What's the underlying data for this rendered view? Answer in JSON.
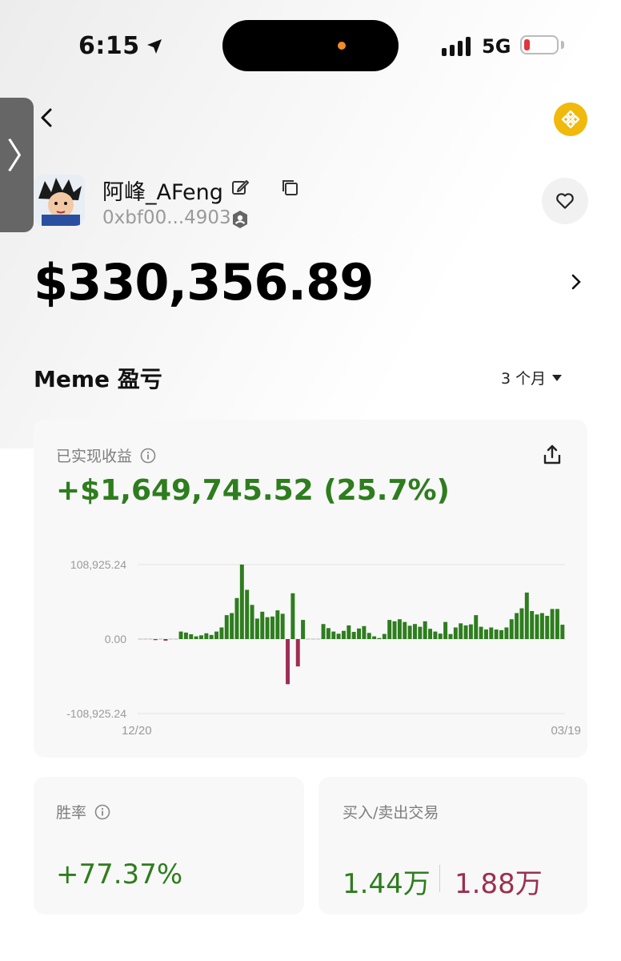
{
  "status_bar": {
    "time": "6:15",
    "network": "5G"
  },
  "profile": {
    "name": "阿峰_AFeng",
    "address": "0xbf00...4903",
    "balance": "$330,356.89"
  },
  "section": {
    "title": "Meme 盈亏",
    "period": "3 个月"
  },
  "pnl": {
    "label": "已实现收益",
    "value": "+$1,649,745.52 (25.7%)"
  },
  "chart_data": {
    "type": "bar",
    "ytick_labels": [
      "108,925.24",
      "0.00",
      "-108,925.24"
    ],
    "ylim": [
      -108925.24,
      108925.24
    ],
    "xtick_labels": [
      "12/20",
      "03/19"
    ],
    "values": [
      0,
      0,
      0,
      -1500,
      0,
      -2300,
      0,
      0,
      11000,
      9500,
      7000,
      4000,
      5500,
      8500,
      6000,
      11000,
      17000,
      35000,
      38000,
      60000,
      109000,
      72000,
      50000,
      30000,
      40000,
      32000,
      33000,
      42000,
      37000,
      -66000,
      67000,
      -40000,
      28000,
      0,
      0,
      0,
      22000,
      16000,
      11000,
      7800,
      12000,
      20000,
      10500,
      15500,
      19000,
      9000,
      4000,
      1500,
      7500,
      28000,
      26000,
      29000,
      25000,
      19500,
      22000,
      18000,
      26000,
      15000,
      11000,
      8000,
      25000,
      7300,
      17000,
      23000,
      20000,
      21500,
      35000,
      18000,
      14000,
      17000,
      14000,
      13000,
      17000,
      29000,
      38000,
      45000,
      68000,
      41000,
      36000,
      38000,
      34000,
      44000,
      44000,
      21000
    ],
    "colors": {
      "positive": "#2e7d1e",
      "negative": "#a02c55",
      "grid": "#e2e2e2",
      "axis_text": "#9a9a9a"
    }
  },
  "stats": {
    "win_rate_label": "胜率",
    "win_rate_value": "+77.37%",
    "trades_label": "买入/卖出交易",
    "buy_count": "1.44万",
    "sell_count": "1.88万"
  },
  "icons": [
    "back-arrow-icon",
    "bnb-coin-icon",
    "edit-icon",
    "copy-icon",
    "shield-user-icon",
    "heart-icon",
    "chevron-right-icon",
    "dropdown-triangle-icon",
    "info-icon",
    "share-icon",
    "location-arrow-icon",
    "signal-icon",
    "battery-icon"
  ]
}
